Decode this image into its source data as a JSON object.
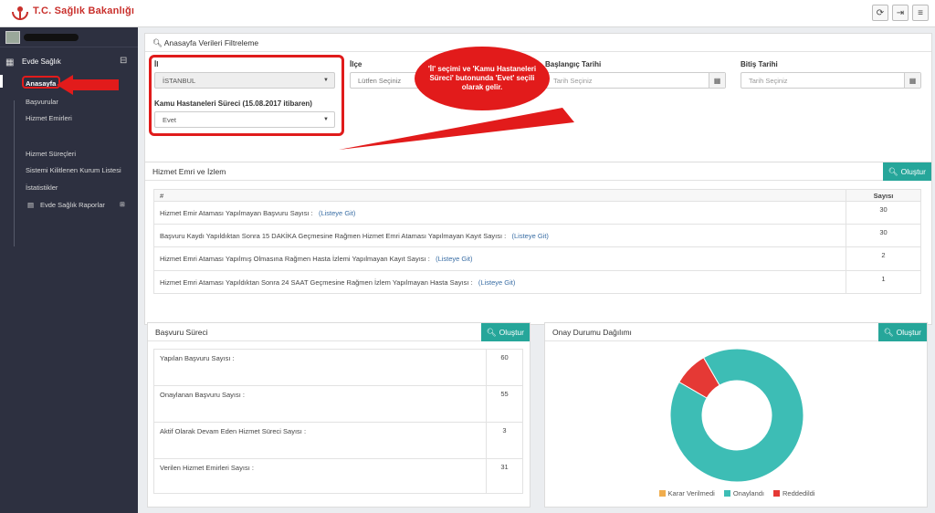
{
  "app": {
    "logo_text": "T.C. Sağlık Bakanlığı"
  },
  "sidebar": {
    "group_label": "Evde Sağlık",
    "items": [
      {
        "label": "Anasayfa"
      },
      {
        "label": "Başvurular"
      },
      {
        "label": "Hizmet Emirleri"
      },
      {
        "label": "Hizmet Süreçleri"
      },
      {
        "label": "Sistemi Kilitlenen Kurum Listesi"
      },
      {
        "label": "İstatistikler"
      },
      {
        "label": "Evde Sağlık Raporlar"
      }
    ]
  },
  "filter": {
    "title": "Anasayfa Verileri Filtreleme",
    "il_label": "İl",
    "il_value": "İSTANBUL",
    "ilce_label": "İlçe",
    "ilce_placeholder": "Lütfen Seçiniz",
    "kamu_label": "Kamu Hastaneleri Süreci (15.08.2017 itibaren)",
    "kamu_value": "Evet",
    "baslangic_label": "Başlangıç Tarihi",
    "baslangic_placeholder": "Tarih Seçiniz",
    "bitis_label": "Bitiş Tarihi",
    "bitis_placeholder": "Tarih Seçiniz"
  },
  "callout": {
    "text": "'İl' seçimi ve 'Kamu Hastaneleri Süreci' butonunda 'Evet' seçili olarak gelir."
  },
  "hizmet": {
    "title": "Hizmet Emri ve İzlem",
    "button": "Oluştur",
    "col_hash": "#",
    "col_count": "Sayısı",
    "rows": [
      {
        "text": "Hizmet Emir Ataması Yapılmayan Başvuru Sayısı :",
        "link": "(Listeye Git)",
        "count": "30"
      },
      {
        "text": "Başvuru Kaydı Yapıldıktan Sonra 15 DAKİKA Geçmesine Rağmen Hizmet Emri Ataması Yapılmayan Kayıt Sayısı :",
        "link": "(Listeye Git)",
        "count": "30"
      },
      {
        "text": "Hizmet Emri Ataması Yapılmış Olmasına Rağmen Hasta İzlemi Yapılmayan Kayıt Sayısı :",
        "link": "(Listeye Git)",
        "count": "2"
      },
      {
        "text": "Hizmet Emri Ataması Yapıldıktan Sonra 24 SAAT Geçmesine Rağmen İzlem Yapılmayan Hasta Sayısı :",
        "link": "(Listeye Git)",
        "count": "1"
      }
    ]
  },
  "basvuru": {
    "title": "Başvuru Süreci",
    "button": "Oluştur",
    "rows": [
      {
        "text": "Yapılan Başvuru Sayısı :",
        "count": "60"
      },
      {
        "text": "Onaylanan Başvuru Sayısı :",
        "count": "55"
      },
      {
        "text": "Aktif Olarak Devam Eden Hizmet Süreci Sayısı :",
        "count": "3"
      },
      {
        "text": "Verilen Hizmet Emirleri Sayısı :",
        "count": "31"
      }
    ]
  },
  "onay": {
    "title": "Onay Durumu Dağılımı",
    "button": "Oluştur",
    "legend": [
      {
        "label": "Karar Verilmedi",
        "color": "#f0ad4e"
      },
      {
        "label": "Onaylandı",
        "color": "#3dbdb5"
      },
      {
        "label": "Reddedildi",
        "color": "#e53935"
      }
    ]
  },
  "chart_data": {
    "type": "pie",
    "labels": [
      "Karar Verilmedi",
      "Onaylandı",
      "Reddedildi"
    ],
    "values": [
      0,
      55,
      5
    ],
    "colors": [
      "#f0ad4e",
      "#3dbdb5",
      "#e53935"
    ],
    "legend": "bottom"
  }
}
